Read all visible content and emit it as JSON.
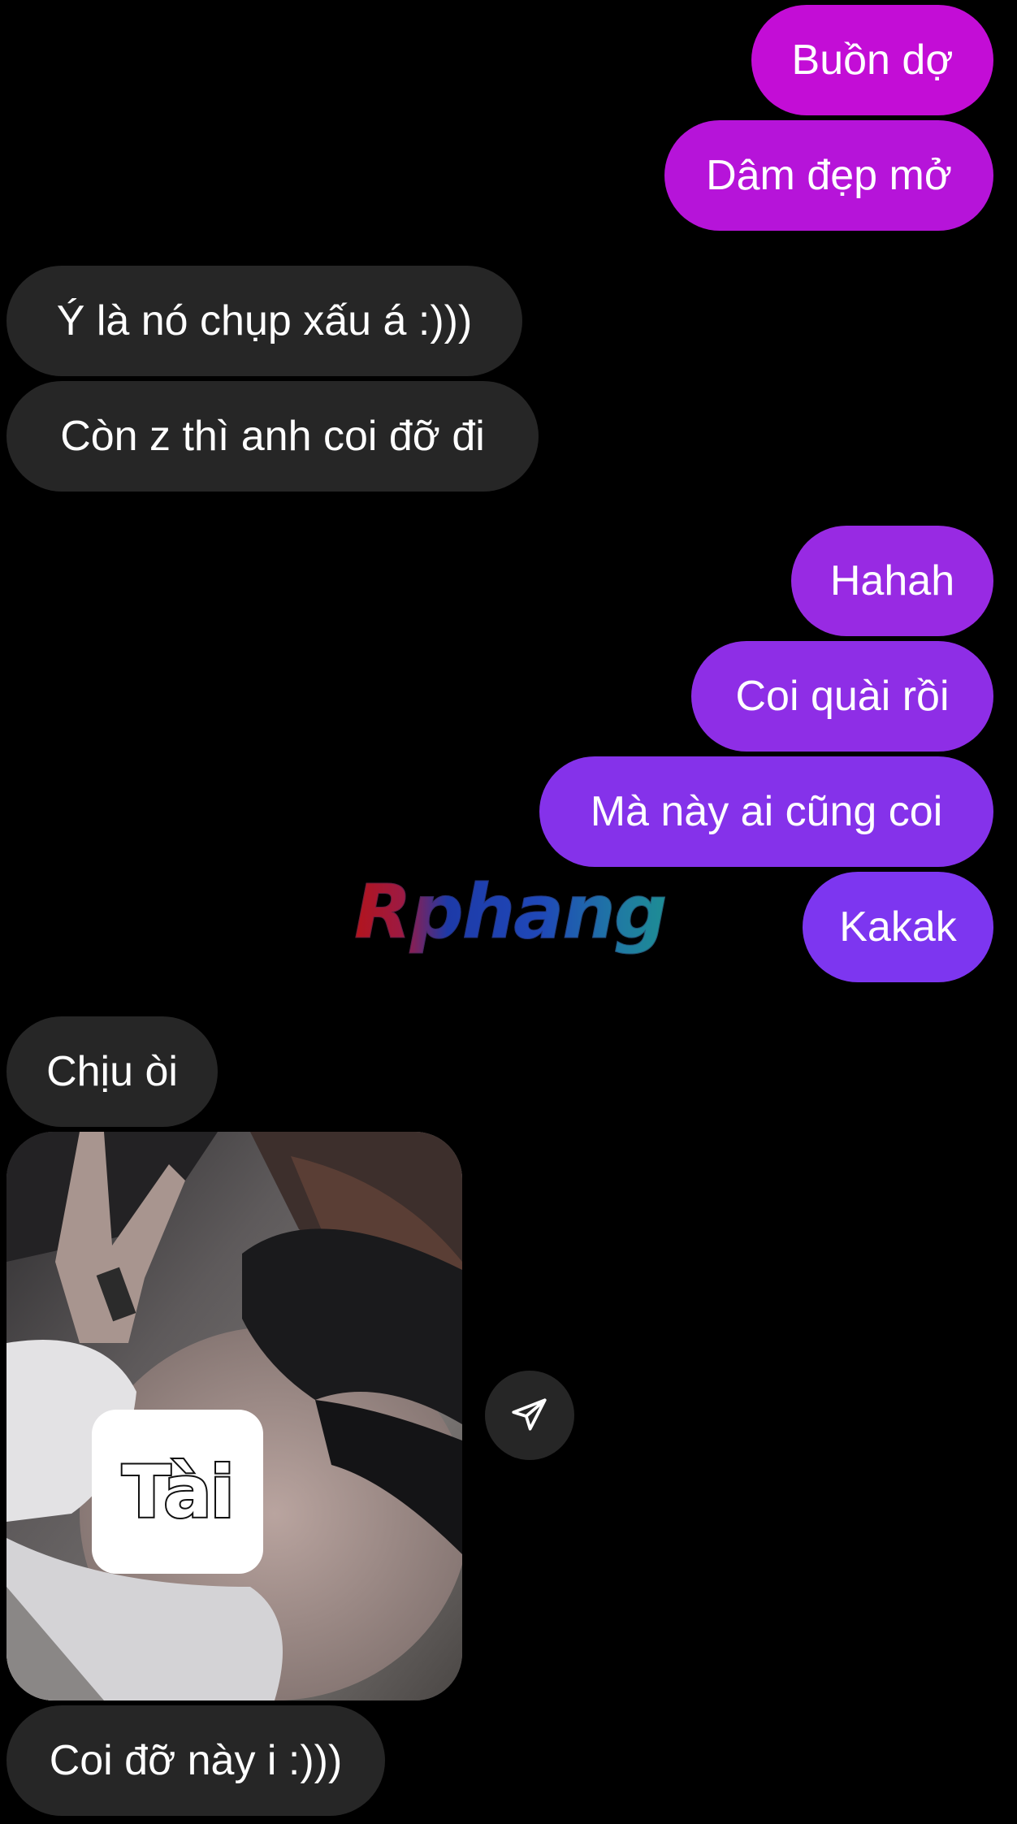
{
  "messages": {
    "m1": "Buồn dợ",
    "m2": "Dâm đẹp mở",
    "m3": "Ý là nó chụp xấu á :)))",
    "m4": "Còn z thì anh coi đỡ đi",
    "m5": "Hahah",
    "m6": "Coi quài rồi",
    "m7": "Mà này ai cũng coi",
    "m8": "Kakak",
    "m9": "Chịu òi",
    "m10": "Coi đỡ này i :)))"
  },
  "photo": {
    "sticker_text": "Tài"
  },
  "watermark": "Rphang",
  "icons": {
    "share": "paper-plane-icon"
  },
  "colors": {
    "background": "#000000",
    "incoming_bubble": "#262626",
    "outgoing_top": "#c20ed6",
    "outgoing_mid": "#8f2ae6",
    "outgoing_bottom": "#7c35f0"
  }
}
